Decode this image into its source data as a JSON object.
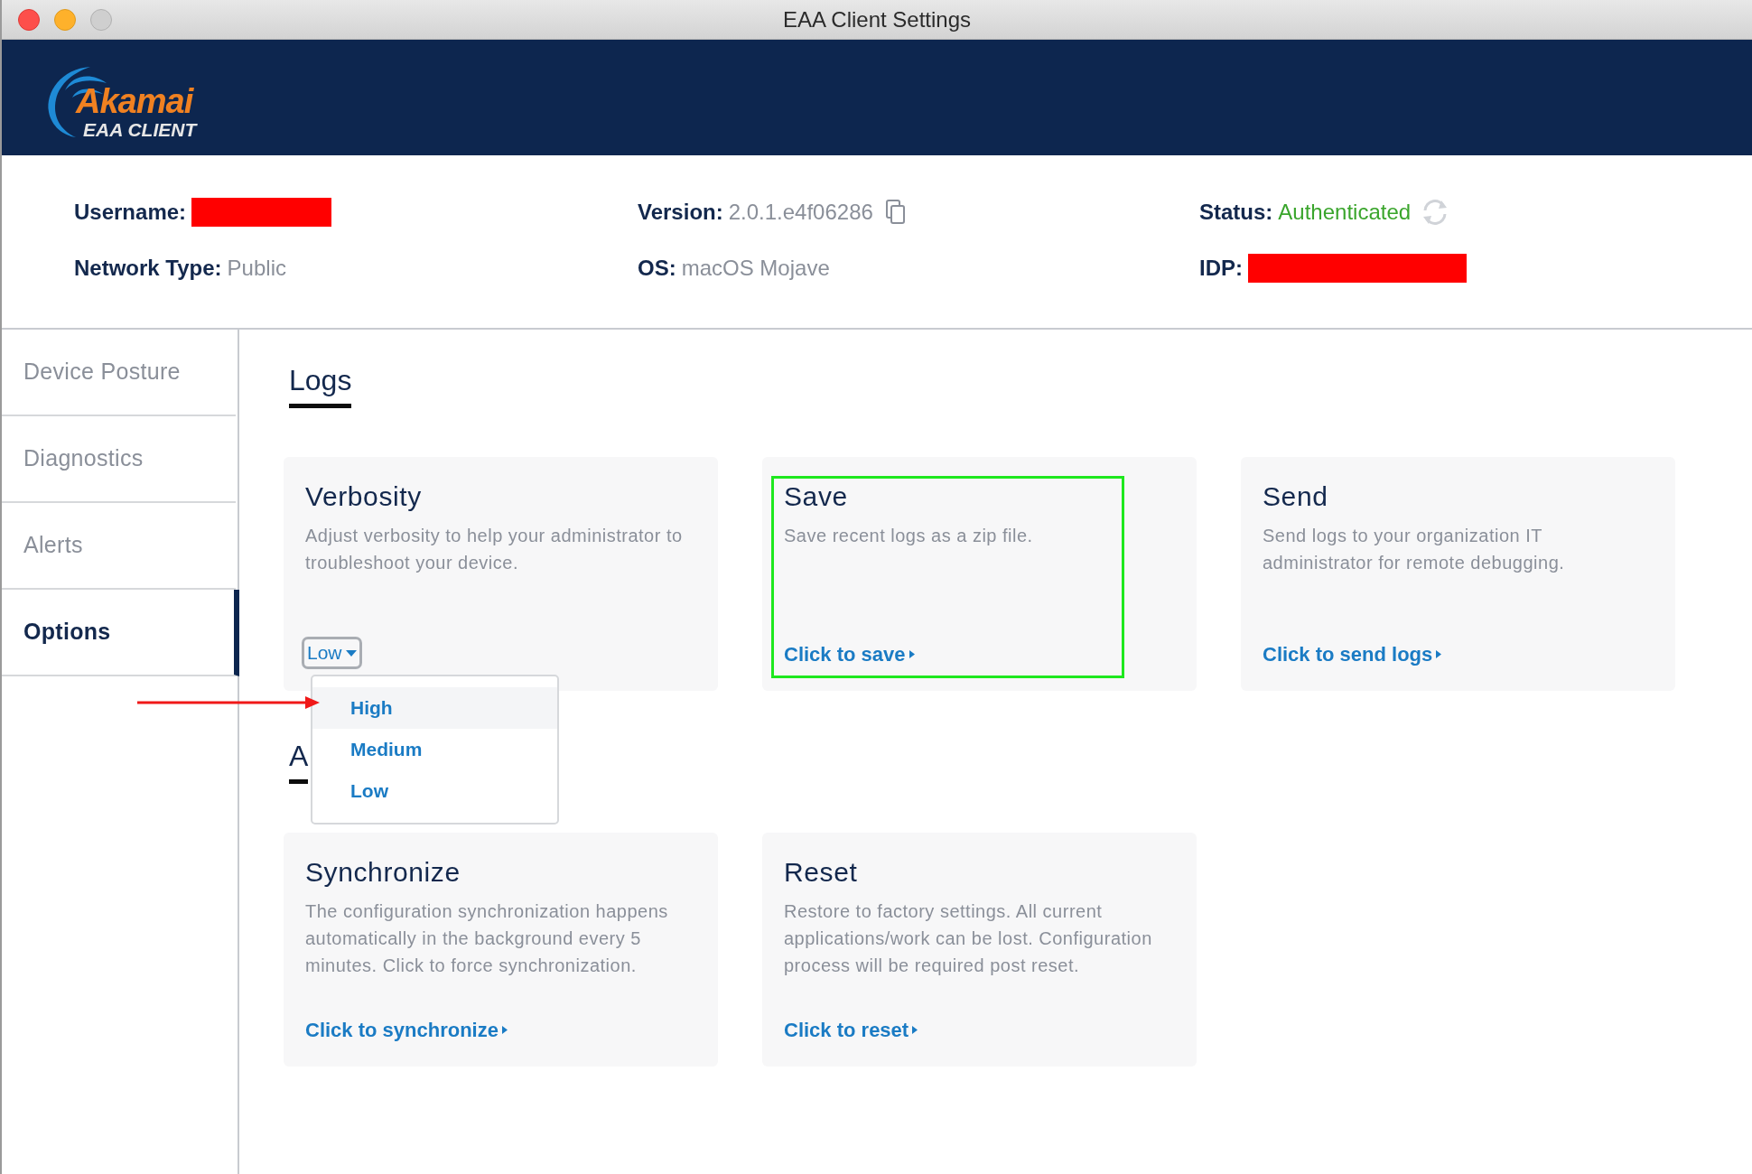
{
  "window": {
    "title": "EAA Client Settings"
  },
  "logo": {
    "name": "Akamai",
    "subtitle": "EAA CLIENT"
  },
  "info": [
    {
      "label": "Username:",
      "kind": "redacted"
    },
    {
      "label": "Version:",
      "value": "2.0.1.e4f06286",
      "kind": "copy"
    },
    {
      "label": "Status:",
      "value": "Authenticated",
      "kind": "status"
    },
    {
      "label": "Network Type:",
      "value": "Public",
      "kind": "text"
    },
    {
      "label": "OS:",
      "value": "macOS Mojave",
      "kind": "text"
    },
    {
      "label": "IDP:",
      "kind": "redacted"
    }
  ],
  "sidebar": {
    "items": [
      {
        "label": "Device Posture",
        "selected": false
      },
      {
        "label": "Diagnostics",
        "selected": false
      },
      {
        "label": "Alerts",
        "selected": false
      },
      {
        "label": "Options",
        "selected": true
      }
    ]
  },
  "sections": [
    {
      "heading": "Logs",
      "cards": [
        {
          "title": "Verbosity",
          "description": "Adjust verbosity to help your administrator to troubleshoot your device.",
          "kind": "dropdown",
          "value": "Low",
          "expanded": true,
          "options": [
            {
              "label": "High",
              "highlighted": true
            },
            {
              "label": "Medium",
              "highlighted": false
            },
            {
              "label": "Low",
              "highlighted": false
            }
          ]
        },
        {
          "title": "Save",
          "description": "Save recent logs as a zip file.",
          "kind": "link",
          "link": "Click to save",
          "highlighted": true
        },
        {
          "title": "Send",
          "description": "Send logs to your organization IT administrator for remote debugging.",
          "kind": "link",
          "link": "Click to send logs",
          "highlighted": false
        }
      ]
    },
    {
      "heading": "A",
      "cards": [
        {
          "title": "Synchronize",
          "description": "The configuration synchronization happens automatically in the background every 5 minutes. Click to force synchronization.",
          "kind": "link",
          "link": "Click to synchronize",
          "highlighted": false
        },
        {
          "title": "Reset",
          "description": "Restore to factory settings. All current applications/work can be lost. Configuration process will be required post reset.",
          "kind": "link",
          "link": "Click to reset",
          "highlighted": false
        }
      ]
    }
  ]
}
